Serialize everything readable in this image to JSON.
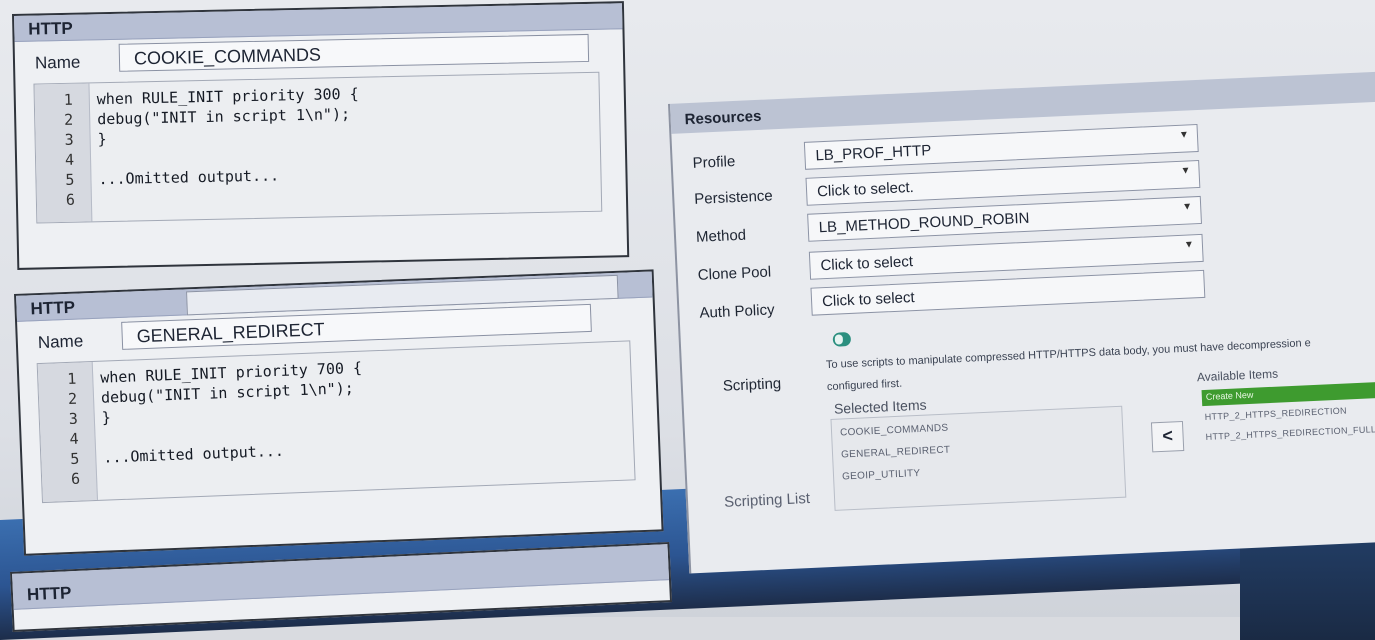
{
  "panels": [
    {
      "header": "HTTP",
      "name_label": "Name",
      "name_value": "COOKIE_COMMANDS",
      "lines": [
        {
          "num": "1",
          "code": "when RULE_INIT priority 300 {"
        },
        {
          "num": "2",
          "code": "debug(\"INIT in script 1\\n\");"
        },
        {
          "num": "3",
          "code": "}"
        },
        {
          "num": "4",
          "code": ""
        },
        {
          "num": "5",
          "code": "...Omitted output..."
        },
        {
          "num": "6",
          "code": ""
        }
      ]
    },
    {
      "header": "HTTP",
      "name_label": "Name",
      "name_value": "GENERAL_REDIRECT",
      "lines": [
        {
          "num": "1",
          "code": "when RULE_INIT priority 700 {"
        },
        {
          "num": "2",
          "code": "debug(\"INIT in script 1\\n\");"
        },
        {
          "num": "3",
          "code": "}"
        },
        {
          "num": "4",
          "code": ""
        },
        {
          "num": "5",
          "code": "...Omitted output..."
        },
        {
          "num": "6",
          "code": ""
        }
      ]
    },
    {
      "header": "HTTP"
    }
  ],
  "resources": {
    "header": "Resources",
    "profile": {
      "label": "Profile",
      "value": "LB_PROF_HTTP"
    },
    "persistence": {
      "label": "Persistence",
      "value": "Click to select."
    },
    "method": {
      "label": "Method",
      "value": "LB_METHOD_ROUND_ROBIN"
    },
    "clone_pool": {
      "label": "Clone Pool",
      "value": "Click to select"
    },
    "auth_policy": {
      "label": "Auth Policy",
      "value": "Click to select"
    },
    "scripting": {
      "label": "Scripting",
      "enabled": true,
      "note_line1": "To use scripts to manipulate compressed HTTP/HTTPS data body, you must have decompression e",
      "note_line2": "configured first."
    },
    "scripting_list": {
      "label": "Scripting List",
      "selected_title": "Selected Items",
      "selected": [
        "COOKIE_COMMANDS",
        "GENERAL_REDIRECT",
        "GEOIP_UTILITY"
      ],
      "available_title": "Available Items",
      "create_new": "Create New",
      "available": [
        "HTTP_2_HTTPS_REDIRECTION",
        "HTTP_2_HTTPS_REDIRECTION_FULL"
      ],
      "move_icon": "chevron-left-icon",
      "move_glyph": "<"
    }
  },
  "colors": {
    "header_bar": "#b7bfd4",
    "toggle_on": "#2b8f7f",
    "create_new_bg": "#3e9b2f"
  }
}
